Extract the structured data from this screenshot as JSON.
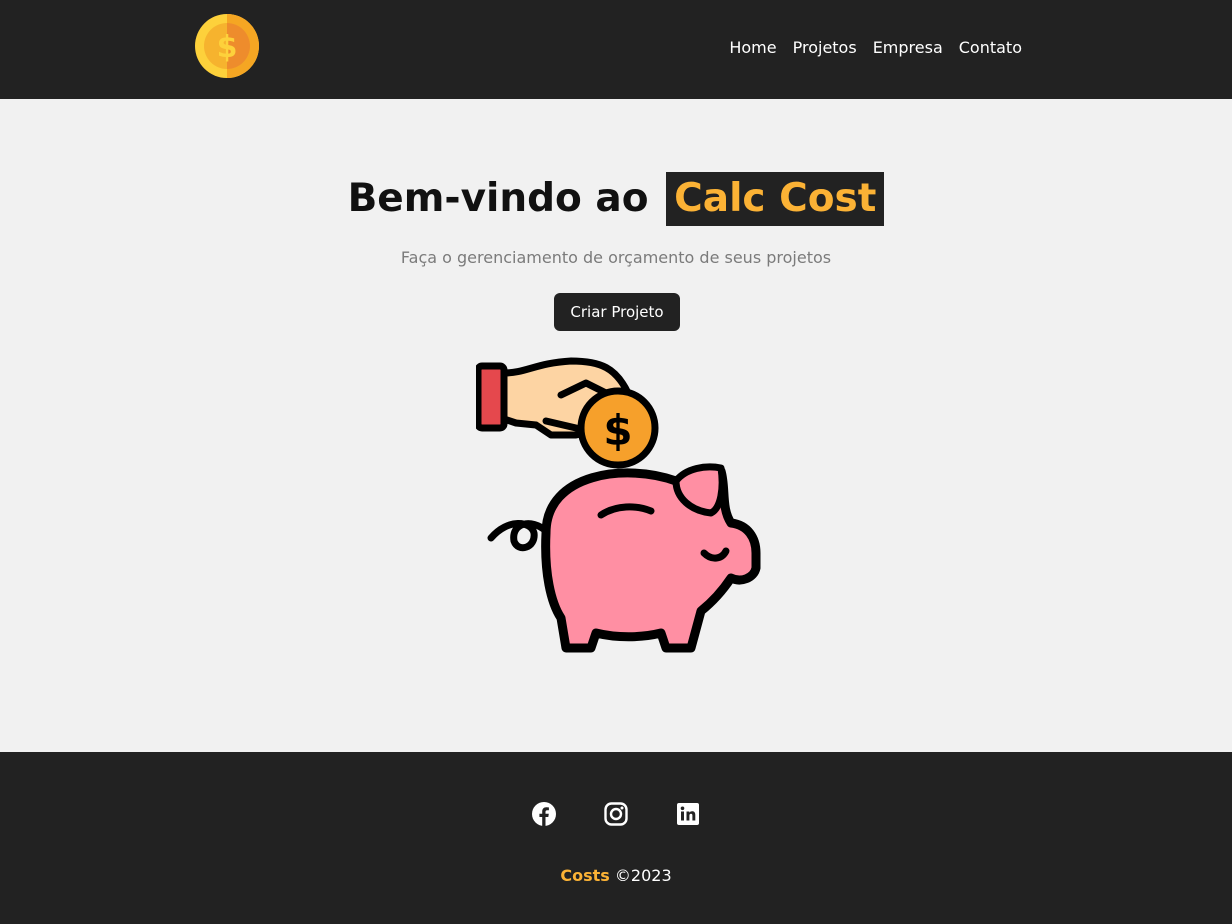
{
  "navbar": {
    "logo_icon": "dollar-coin-icon",
    "links": [
      {
        "label": "Home"
      },
      {
        "label": "Projetos"
      },
      {
        "label": "Empresa"
      },
      {
        "label": "Contato"
      }
    ]
  },
  "hero": {
    "title_prefix": "Bem-vindo ao",
    "title_brand": "Calc Cost",
    "subtitle": "Faça o gerenciamento de orçamento de seus projetos",
    "cta_label": "Criar Projeto",
    "illustration_icon": "piggy-bank-coin-icon"
  },
  "footer": {
    "social": [
      {
        "icon": "facebook-icon"
      },
      {
        "icon": "instagram-icon"
      },
      {
        "icon": "linkedin-icon"
      }
    ],
    "brand": "Costs",
    "copyright": "©2023"
  },
  "colors": {
    "dark": "#222222",
    "accent": "#fbb235",
    "background": "#f1f1f1",
    "muted_text": "#7b7b7b"
  }
}
